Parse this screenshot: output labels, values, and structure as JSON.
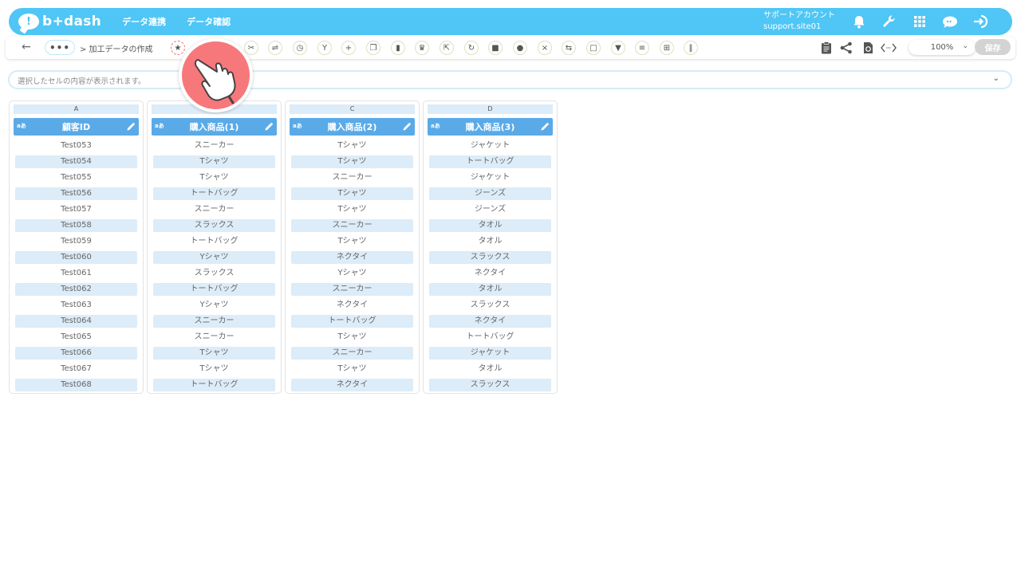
{
  "header": {
    "logo_text": "b+dash",
    "nav": [
      "データ連携",
      "データ確認"
    ],
    "account_name": "サポートアカウント",
    "account_id": "support.site01",
    "icons": [
      "bell-icon",
      "wrench-icon",
      "apps-grid-icon",
      "chat-bubble-icon",
      "logout-icon"
    ],
    "brand_color": "#4fc6f5"
  },
  "toolbar": {
    "more_label": "•••",
    "breadcrumb": "> 加工データの作成",
    "zoom": "100%",
    "save_label": "保存",
    "tools": [
      "star-icon",
      "cut-icon",
      "merge-icon",
      "timer-icon",
      "branch-icon",
      "plus-icon",
      "copy-icon",
      "trash-icon",
      "crown-icon",
      "expand-icon",
      "repeat-icon",
      "lock-icon",
      "bag-icon",
      "close-circle-icon",
      "shuffle-icon",
      "box-icon",
      "filter-icon",
      "text-icon",
      "grid-icon",
      "split-icon"
    ]
  },
  "preview": {
    "placeholder": "選択したセルの内容が表示されます。"
  },
  "columns": [
    {
      "letter": "A",
      "type_badge": "aあ",
      "title": "顧客ID",
      "cells": [
        "Test053",
        "Test054",
        "Test055",
        "Test056",
        "Test057",
        "Test058",
        "Test059",
        "Test060",
        "Test061",
        "Test062",
        "Test063",
        "Test064",
        "Test065",
        "Test066",
        "Test067",
        "Test068"
      ]
    },
    {
      "letter": "B",
      "type_badge": "aあ",
      "title": "購入商品(1)",
      "cells": [
        "スニーカー",
        "Tシャツ",
        "Tシャツ",
        "トートバッグ",
        "スニーカー",
        "スラックス",
        "トートバッグ",
        "Yシャツ",
        "スラックス",
        "トートバッグ",
        "Yシャツ",
        "スニーカー",
        "スニーカー",
        "Tシャツ",
        "Tシャツ",
        "トートバッグ"
      ]
    },
    {
      "letter": "C",
      "type_badge": "aあ",
      "title": "購入商品(2)",
      "cells": [
        "Tシャツ",
        "Tシャツ",
        "スニーカー",
        "Tシャツ",
        "Tシャツ",
        "スニーカー",
        "Tシャツ",
        "ネクタイ",
        "Yシャツ",
        "スニーカー",
        "ネクタイ",
        "トートバッグ",
        "Tシャツ",
        "スニーカー",
        "Tシャツ",
        "ネクタイ"
      ]
    },
    {
      "letter": "D",
      "type_badge": "aあ",
      "title": "購入商品(3)",
      "cells": [
        "ジャケット",
        "トートバッグ",
        "ジャケット",
        "ジーンズ",
        "ジーンズ",
        "タオル",
        "タオル",
        "スラックス",
        "ネクタイ",
        "タオル",
        "スラックス",
        "ネクタイ",
        "トートバッグ",
        "ジャケット",
        "タオル",
        "スラックス"
      ]
    }
  ]
}
